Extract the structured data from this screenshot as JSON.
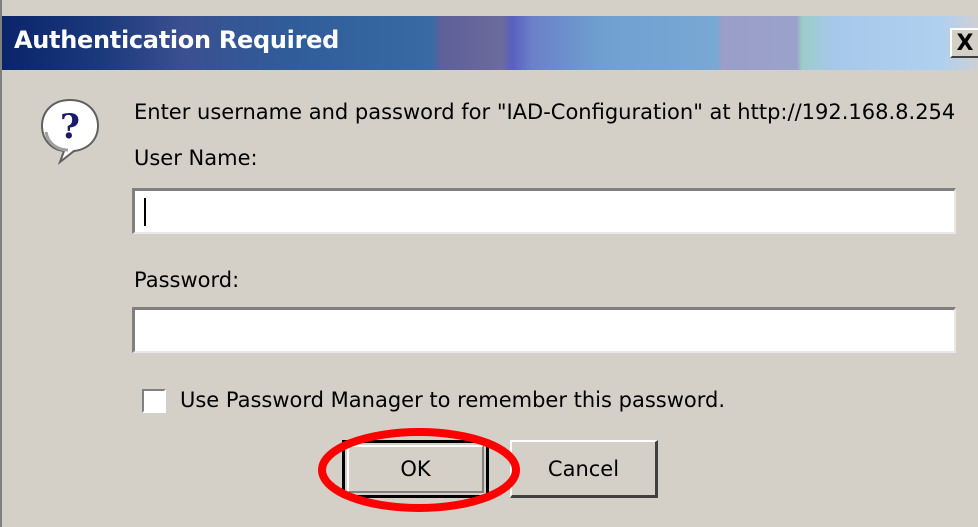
{
  "dialog": {
    "title": "Authentication Required",
    "close_label": "X",
    "prompt": "Enter username and password for \"IAD-Configuration\" at http://192.168.8.254",
    "username_label": "User Name:",
    "username_value": "",
    "password_label": "Password:",
    "password_value": "",
    "remember_label": "Use Password Manager to remember this password.",
    "remember_checked": false,
    "ok_label": "OK",
    "cancel_label": "Cancel",
    "icon": "question-balloon-icon"
  },
  "annotation": {
    "shape": "ellipse",
    "color": "#ff0000",
    "target": "ok-button"
  }
}
